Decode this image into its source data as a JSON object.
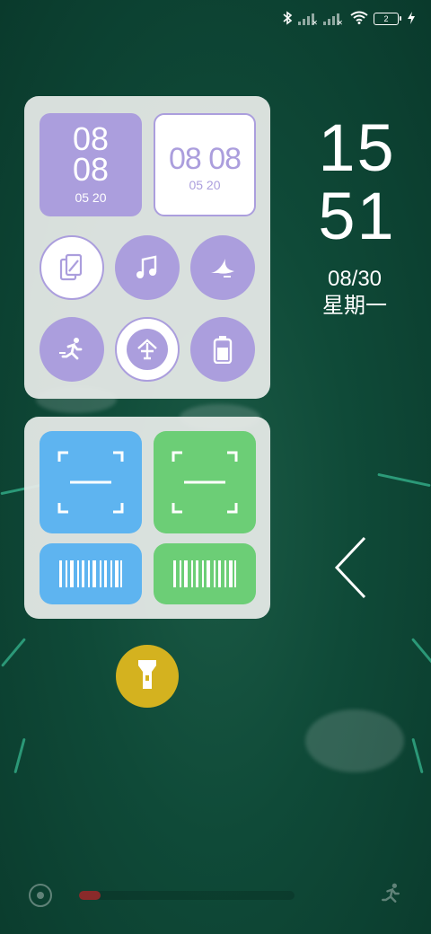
{
  "status_bar": {
    "battery_level": "2",
    "icons": [
      "bluetooth-icon",
      "signal-icon",
      "signal-icon",
      "wifi-icon",
      "battery-icon",
      "charging-icon"
    ]
  },
  "widget_panel": {
    "clock_tile_a": {
      "hour": "08",
      "minute": "08",
      "date": "05 20"
    },
    "clock_tile_b": {
      "time": "08 08",
      "date": "05 20"
    },
    "shortcuts": [
      "edit-notes-icon",
      "music-icon",
      "bird-icon",
      "running-icon",
      "umbrella-app-icon",
      "battery-app-icon"
    ]
  },
  "scanner_panel": {
    "items": [
      "scan-qr-blue",
      "scan-qr-green",
      "barcode-blue",
      "barcode-green"
    ]
  },
  "lock_clock": {
    "hour": "15",
    "minute": "51",
    "date": "08/30",
    "weekday": "星期一"
  },
  "colors": {
    "purple": "#ab9edd",
    "blue": "#5eb4f0",
    "green": "#6cce76",
    "torch": "#d4b21f",
    "panel": "#e8ecea"
  }
}
